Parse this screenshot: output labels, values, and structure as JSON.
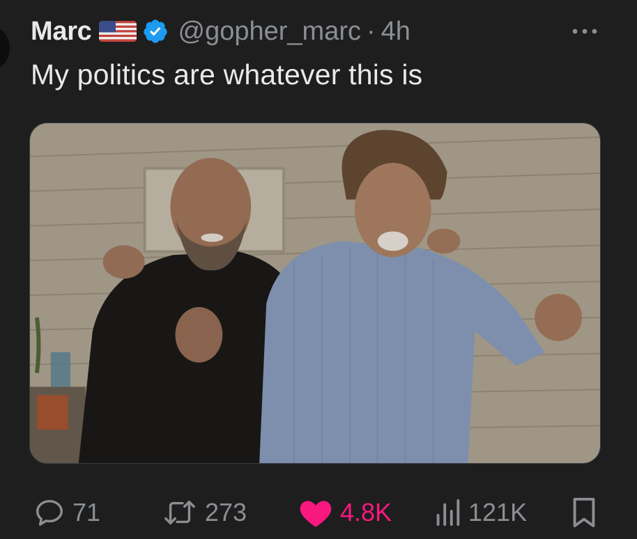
{
  "tweet": {
    "author_name": "Marc",
    "handle": "@gopher_marc",
    "separator": "·",
    "time": "4h",
    "text": "My politics are whatever this is",
    "flag_icon": "us-flag-icon",
    "verified_icon": "verified-badge-icon",
    "verified_color": "#1d9bf0",
    "media_description": "photo-of-two-men-posing-arm-in-arm"
  },
  "actions": {
    "replies": "71",
    "retweets": "273",
    "likes": "4.8K",
    "views": "121K",
    "like_color": "#f91880",
    "icons": [
      "reply-icon",
      "retweet-icon",
      "heart-icon",
      "views-icon",
      "bookmark-icon"
    ]
  },
  "colors": {
    "background": "#1e1e1e",
    "text": "#e7e9ea",
    "muted": "#8b8f94"
  }
}
